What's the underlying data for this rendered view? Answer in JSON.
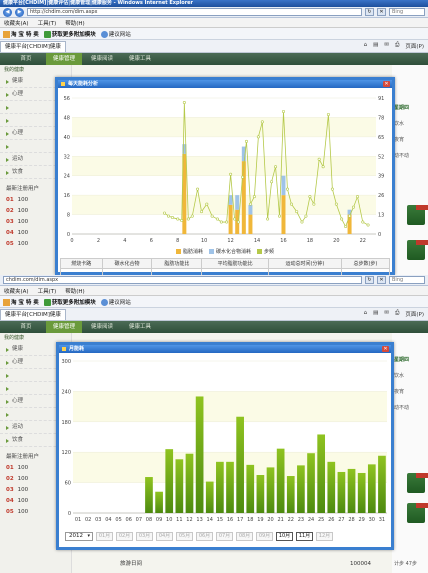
{
  "browser": {
    "title": "健康平台[CHDIM]|健康评估|健康管理|健康服务 - Windows Internet Explorer",
    "url": "http://chdim.com/dim.aspx",
    "search_placeholder": "Bing",
    "menu": [
      "收藏夹(A)",
      "工具(T)",
      "帮助(H)"
    ],
    "favorites": [
      "淘 宝 特 卖",
      "获取更多附加模块",
      "建议网站"
    ],
    "tab_label": "健康平台[CHDIM]健康",
    "toolbar": [
      "页面(P)"
    ]
  },
  "browser2": {
    "url": "chdim.com/dim.aspx",
    "menu": [
      "收藏夹(A)",
      "工具(T)",
      "帮助(H)"
    ],
    "favorites": [
      "淘 宝 特 卖",
      "获取更多附加模块",
      "建议网站"
    ],
    "tab_label": "健康平台[CHDIM]健康",
    "toolbar": [
      "页面(P)"
    ]
  },
  "site": {
    "nav": [
      "首页",
      "健康管理",
      "健康阅读",
      "健康工具"
    ],
    "sidebar_header": "我的健康",
    "sidebar_items": [
      "健康",
      "心理",
      "",
      "",
      "心理",
      "",
      "运动",
      "饮食"
    ],
    "section_title": "最新注册用户",
    "ranks": [
      {
        "n": "01",
        "v": "100"
      },
      {
        "n": "02",
        "v": "100"
      },
      {
        "n": "03",
        "v": "100"
      },
      {
        "n": "04",
        "v": "100"
      },
      {
        "n": "05",
        "v": "100"
      }
    ],
    "ranks2": [
      {
        "n": "01",
        "v": "100"
      },
      {
        "n": "02",
        "v": "100"
      },
      {
        "n": "03",
        "v": "100"
      },
      {
        "n": "04",
        "v": "100"
      },
      {
        "n": "05",
        "v": "100"
      }
    ],
    "right_texts": [
      "星期四",
      "饮水",
      "夜宵",
      "动不动"
    ],
    "bottom_user": "100004",
    "bottom_steps": "计步 47步",
    "bottom_label": "旅游日间"
  },
  "dialog1": {
    "title": "每天能耗分析",
    "legend": [
      "脂肪消耗",
      "碳水化合物消耗",
      "步频"
    ],
    "colors": {
      "bar1": "#f0b73a",
      "bar2": "#9fc3e8",
      "line": "#b5c94a"
    },
    "table_headers": [
      "燃烧卡路",
      "碳水化合物",
      "脂肪功能比",
      "平均脂肪功能比",
      "运动总时间(分钟)",
      "总步数(步)"
    ]
  },
  "dialog2": {
    "title": "月能耗",
    "year": "2012",
    "months": [
      "01月",
      "02月",
      "03月",
      "04月",
      "05月",
      "06月",
      "07月",
      "08月",
      "09月",
      "10月",
      "11月",
      "12月"
    ],
    "active_months": [
      "10月",
      "11月"
    ]
  },
  "chart_data": [
    {
      "type": "line",
      "title": "",
      "xlim": [
        0,
        23
      ],
      "ylim_left": [
        0,
        56
      ],
      "ylim_right": [
        0,
        91
      ],
      "y_ticks_left": [
        0,
        8,
        16,
        24,
        32,
        40,
        48,
        56
      ],
      "y_ticks_right": [
        0,
        13,
        26,
        39,
        52,
        65,
        78,
        91
      ],
      "x_ticks": [
        0,
        2,
        4,
        6,
        8,
        10,
        12,
        14,
        16,
        18,
        20,
        22
      ],
      "series": [
        {
          "name": "脂肪消耗",
          "type": "bar",
          "x": [
            8.5,
            12.0,
            12.5,
            13.0,
            13.5,
            16.0,
            21.0
          ],
          "values": [
            33,
            12,
            10,
            30,
            8,
            16,
            8
          ]
        },
        {
          "name": "碳水化合物消耗",
          "type": "bar",
          "x": [
            8.5,
            12.0,
            12.5,
            13.0,
            13.5,
            16.0,
            21.0
          ],
          "values": [
            4,
            4,
            6,
            6,
            4,
            8,
            2
          ]
        },
        {
          "name": "步频",
          "type": "line",
          "axis": "right",
          "x": [
            7.0,
            7.3,
            7.6,
            8.0,
            8.3,
            8.5,
            8.8,
            9.1,
            9.5,
            9.8,
            10.2,
            10.6,
            11.0,
            11.3,
            11.7,
            12.0,
            12.3,
            12.6,
            12.9,
            13.2,
            13.5,
            13.8,
            14.1,
            14.4,
            14.8,
            15.1,
            15.4,
            15.7,
            16.0,
            16.3,
            16.6,
            17.0,
            17.4,
            17.7,
            18.0,
            18.3,
            18.7,
            19.0,
            19.4,
            19.7,
            20.0,
            20.4,
            20.7,
            21.0,
            21.3,
            21.6,
            22.0,
            22.4
          ],
          "values": [
            14,
            12,
            11,
            10,
            9,
            88,
            10,
            12,
            30,
            15,
            20,
            12,
            10,
            8,
            8,
            40,
            10,
            8,
            38,
            62,
            20,
            25,
            65,
            75,
            10,
            35,
            45,
            12,
            82,
            30,
            20,
            15,
            8,
            12,
            25,
            20,
            50,
            45,
            80,
            30,
            20,
            10,
            5,
            12,
            18,
            25,
            8,
            6
          ]
        }
      ]
    },
    {
      "type": "bar",
      "title": "",
      "ylim": [
        0,
        300
      ],
      "y_ticks": [
        0,
        60,
        120,
        180,
        240,
        300
      ],
      "categories": [
        "01",
        "02",
        "03",
        "04",
        "05",
        "06",
        "07",
        "08",
        "09",
        "10",
        "11",
        "12",
        "13",
        "14",
        "15",
        "16",
        "17",
        "18",
        "19",
        "20",
        "21",
        "22",
        "23",
        "24",
        "25",
        "26",
        "27",
        "28",
        "29",
        "30",
        "31"
      ],
      "values": [
        0,
        0,
        0,
        0,
        0,
        0,
        0,
        71,
        42,
        126,
        106,
        117,
        230,
        62,
        101,
        101,
        190,
        95,
        75,
        90,
        127,
        73,
        94,
        118,
        155,
        101,
        81,
        87,
        79,
        96,
        113
      ]
    }
  ]
}
